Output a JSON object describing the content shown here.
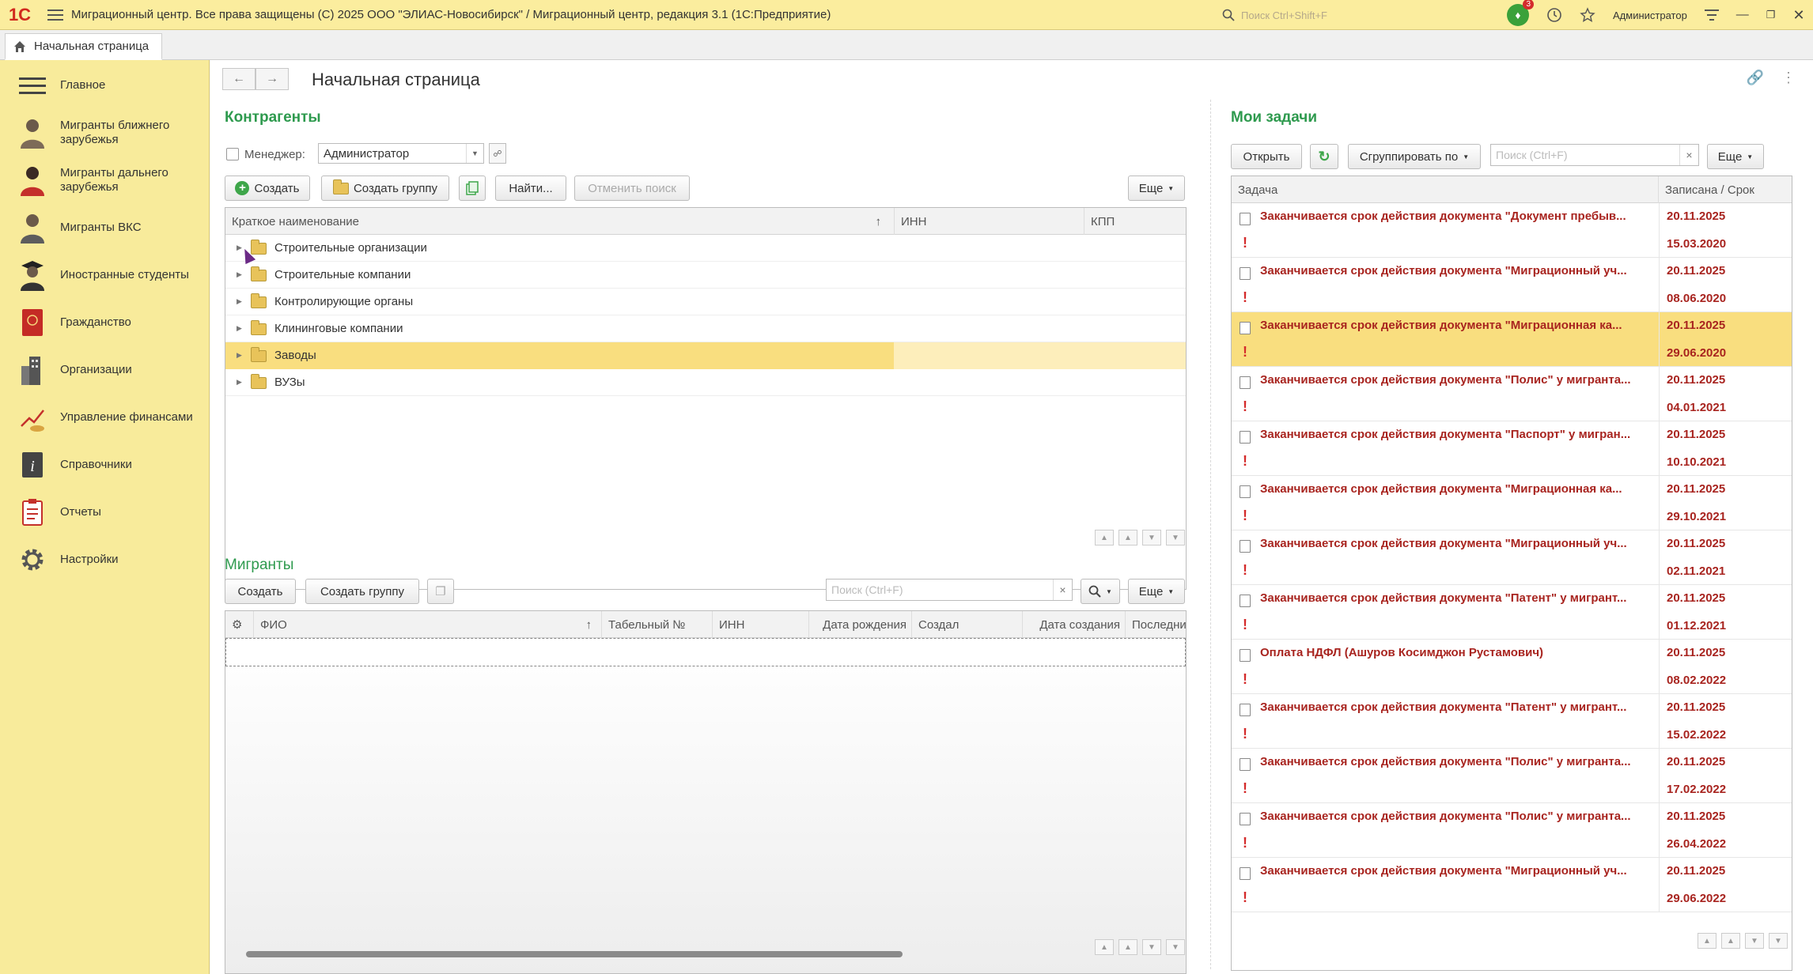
{
  "titlebar": {
    "title": "Миграционный центр. Все права защищены (С) 2025 ООО \"ЭЛИАС-Новосибирск\" / Миграционный центр, редакция 3.1  (1С:Предприятие)",
    "search_placeholder": "Поиск Ctrl+Shift+F",
    "notification_count": "3",
    "user": "Администратор"
  },
  "tabs": [
    {
      "label": "Начальная страница"
    }
  ],
  "sidebar": {
    "items": [
      {
        "label": "Главное",
        "icon": "menu-icon"
      },
      {
        "label": "Мигранты ближнего зарубежья",
        "icon": "person-icon"
      },
      {
        "label": "Мигранты дальнего зарубежья",
        "icon": "person-icon"
      },
      {
        "label": "Мигранты ВКС",
        "icon": "person-icon"
      },
      {
        "label": "Иностранные студенты",
        "icon": "student-icon"
      },
      {
        "label": "Гражданство",
        "icon": "passport-icon"
      },
      {
        "label": "Организации",
        "icon": "building-icon"
      },
      {
        "label": "Управление финансами",
        "icon": "finance-icon"
      },
      {
        "label": "Справочники",
        "icon": "info-icon"
      },
      {
        "label": "Отчеты",
        "icon": "report-icon"
      },
      {
        "label": "Настройки",
        "icon": "gear-icon"
      }
    ]
  },
  "page": {
    "title": "Начальная страница"
  },
  "contractors": {
    "title": "Контрагенты",
    "manager_label": "Менеджер:",
    "manager_value": "Администратор",
    "buttons": {
      "create": "Создать",
      "create_group": "Создать группу",
      "find": "Найти...",
      "cancel_search": "Отменить поиск",
      "more": "Еще"
    },
    "columns": [
      "Краткое наименование",
      "ИНН",
      "КПП"
    ],
    "sort_indicator": "↑",
    "rows": [
      {
        "name": "Строительные организации"
      },
      {
        "name": "Строительные компании"
      },
      {
        "name": "Контролирующие органы"
      },
      {
        "name": "Клининговые компании"
      },
      {
        "name": "Заводы",
        "selected": true
      },
      {
        "name": "ВУЗы"
      }
    ]
  },
  "migrants": {
    "title": "Мигранты",
    "buttons": {
      "create": "Создать",
      "create_group": "Создать группу",
      "more": "Еще"
    },
    "search_placeholder": "Поиск (Ctrl+F)",
    "columns": [
      "ФИО",
      "Табельный №",
      "ИНН",
      "Дата рождения",
      "Создал",
      "Дата создания",
      "Последний"
    ],
    "sort_indicator": "↑"
  },
  "tasks": {
    "title": "Мои задачи",
    "buttons": {
      "open": "Открыть",
      "group_by": "Сгруппировать по",
      "more": "Еще"
    },
    "search_placeholder": "Поиск (Ctrl+F)",
    "columns": [
      "Задача",
      "Записана / Срок"
    ],
    "rows": [
      {
        "text": "Заканчивается срок действия документа \"Документ пребыв...",
        "recorded": "20.11.2025",
        "deadline": "15.03.2020"
      },
      {
        "text": "Заканчивается срок действия документа \"Миграционный уч...",
        "recorded": "20.11.2025",
        "deadline": "08.06.2020"
      },
      {
        "text": "Заканчивается срок действия документа \"Миграционная ка...",
        "recorded": "20.11.2025",
        "deadline": "29.06.2020",
        "selected": true
      },
      {
        "text": "Заканчивается срок действия документа \"Полис\" у мигранта...",
        "recorded": "20.11.2025",
        "deadline": "04.01.2021"
      },
      {
        "text": "Заканчивается срок действия документа \"Паспорт\" у мигран...",
        "recorded": "20.11.2025",
        "deadline": "10.10.2021"
      },
      {
        "text": "Заканчивается срок действия документа \"Миграционная ка...",
        "recorded": "20.11.2025",
        "deadline": "29.10.2021"
      },
      {
        "text": "Заканчивается срок действия документа \"Миграционный уч...",
        "recorded": "20.11.2025",
        "deadline": "02.11.2021"
      },
      {
        "text": "Заканчивается срок действия документа \"Патент\" у мигрант...",
        "recorded": "20.11.2025",
        "deadline": "01.12.2021"
      },
      {
        "text": "Оплата НДФЛ (Ашуров Косимджон Рустамович)",
        "recorded": "20.11.2025",
        "deadline": "08.02.2022"
      },
      {
        "text": "Заканчивается срок действия документа \"Патент\" у мигрант...",
        "recorded": "20.11.2025",
        "deadline": "15.02.2022"
      },
      {
        "text": "Заканчивается срок действия документа \"Полис\" у мигранта...",
        "recorded": "20.11.2025",
        "deadline": "17.02.2022"
      },
      {
        "text": "Заканчивается срок действия документа \"Полис\" у мигранта...",
        "recorded": "20.11.2025",
        "deadline": "26.04.2022"
      },
      {
        "text": "Заканчивается срок действия документа \"Миграционный уч...",
        "recorded": "20.11.2025",
        "deadline": "29.06.2022"
      }
    ]
  },
  "colors": {
    "accent_green": "#2e9a4e",
    "task_red": "#a8241f",
    "selection": "#f9de7f",
    "sidebar_bg": "#f8eb9b"
  }
}
